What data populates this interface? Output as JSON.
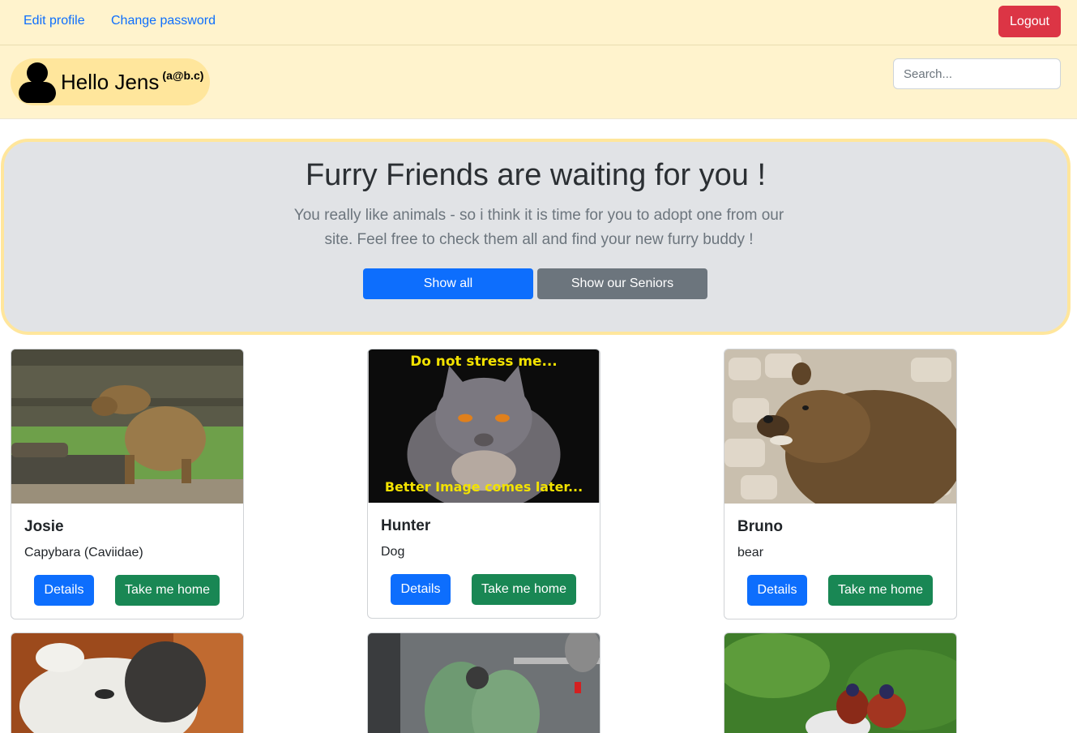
{
  "topnav": {
    "edit_profile": "Edit profile",
    "change_password": "Change password",
    "logout": "Logout"
  },
  "header": {
    "greeting": "Hello Jens",
    "email": "(a@b.c)",
    "search_placeholder": "Search..."
  },
  "hero": {
    "title": "Furry Friends are waiting for you !",
    "lead": "You really like animals - so i think it is time for you to adopt one from our site. Feel free to check them all and find your new furry buddy !",
    "show_all": "Show all",
    "show_seniors": "Show our Seniors"
  },
  "animals": [
    {
      "name": "Josie",
      "species": "Capybara (Caviidae)",
      "details": "Details",
      "adopt": "Take me home"
    },
    {
      "name": "Hunter",
      "species": "Dog",
      "details": "Details",
      "adopt": "Take me home",
      "image_caption_top": "Do not stress me...",
      "image_caption_bottom": "Better Image comes later..."
    },
    {
      "name": "Bruno",
      "species": "bear",
      "details": "Details",
      "adopt": "Take me home"
    }
  ],
  "colors": {
    "nav_bg": "#fff3cd",
    "pill_bg": "#ffe69c",
    "primary": "#0d6efd",
    "secondary": "#6c757d",
    "success": "#198754",
    "danger": "#dc3545",
    "hero_bg": "#e1e3e6"
  }
}
